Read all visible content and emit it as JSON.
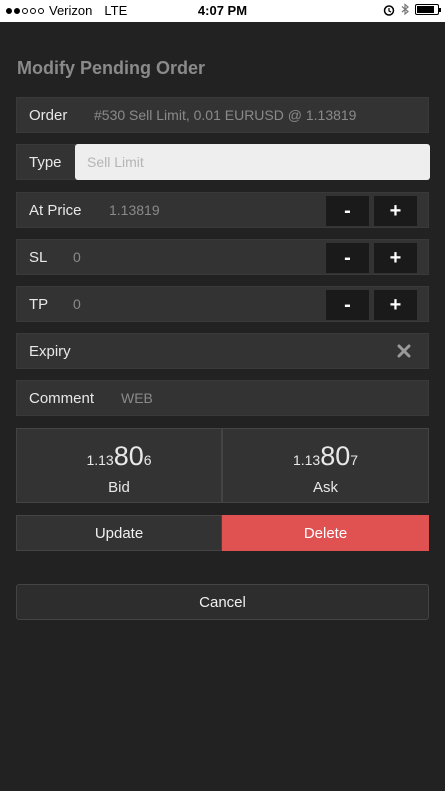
{
  "status_bar": {
    "carrier": "Verizon",
    "network": "LTE",
    "time": "4:07 PM"
  },
  "title": "Modify Pending Order",
  "order": {
    "label": "Order",
    "value": "#530 Sell Limit, 0.01 EURUSD @ 1.13819"
  },
  "type": {
    "label": "Type",
    "value": "Sell Limit"
  },
  "at_price": {
    "label": "At Price",
    "value": "1.13819",
    "minus": "-",
    "plus": "+"
  },
  "sl": {
    "label": "SL",
    "value": "0",
    "minus": "-",
    "plus": "+"
  },
  "tp": {
    "label": "TP",
    "value": "0",
    "minus": "-",
    "plus": "+"
  },
  "expiry": {
    "label": "Expiry",
    "clear_icon": "close-x-icon"
  },
  "comment": {
    "label": "Comment",
    "value": "WEB"
  },
  "bid": {
    "prefix": "1.13",
    "big": "80",
    "suffix": "6",
    "label": "Bid"
  },
  "ask": {
    "prefix": "1.13",
    "big": "80",
    "suffix": "7",
    "label": "Ask"
  },
  "buttons": {
    "update": "Update",
    "delete": "Delete",
    "cancel": "Cancel"
  },
  "colors": {
    "delete": "#e05252",
    "background": "#222222",
    "row": "#333333"
  }
}
